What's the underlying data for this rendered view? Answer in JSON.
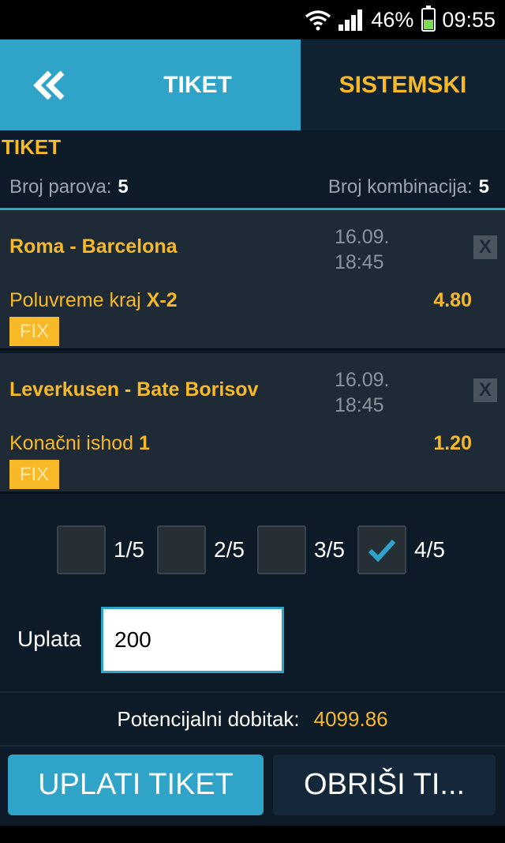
{
  "status_bar": {
    "battery": "46%",
    "battery_level": 0.46,
    "time": "09:55",
    "icons": [
      "wifi-icon",
      "signal-icon",
      "battery-icon"
    ]
  },
  "tabs": {
    "back_icon": "double-chevron-left-icon",
    "tiket": "TIKET",
    "sistemski": "SISTEMSKI"
  },
  "ticket": {
    "title": "TIKET",
    "broj_parova_label": "Broj parova:",
    "broj_parova": "5",
    "broj_kombinacija_label": "Broj kombinacija:",
    "broj_kombinacija": "5"
  },
  "matches": [
    {
      "teams": "Roma - Barcelona",
      "date": "16.09.",
      "time": "18:45",
      "pick_label": "Poluvreme kraj",
      "pick_value": "X-2",
      "odds": "4.80",
      "fix": "FIX",
      "close": "X"
    },
    {
      "teams": "Leverkusen - Bate Borisov",
      "date": "16.09.",
      "time": "18:45",
      "pick_label": "Konačni ishod",
      "pick_value": "1",
      "odds": "1.20",
      "fix": "FIX",
      "close": "X"
    }
  ],
  "combinations": [
    {
      "label": "1/5",
      "checked": false
    },
    {
      "label": "2/5",
      "checked": false
    },
    {
      "label": "3/5",
      "checked": false
    },
    {
      "label": "4/5",
      "checked": true
    }
  ],
  "uplata": {
    "label": "Uplata",
    "value": "200"
  },
  "potencijalni": {
    "label": "Potencijalni dobitak:",
    "value": "4099.86"
  },
  "buttons": {
    "uplati": "UPLATI TIKET",
    "obrisi": "OBRIŠI TI..."
  },
  "colors": {
    "accent_blue": "#2fa3c8",
    "accent_gold": "#f7b928",
    "background": "#0d1b29",
    "card": "#1e2a36"
  }
}
